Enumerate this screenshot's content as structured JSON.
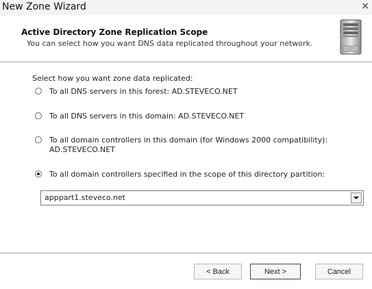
{
  "window": {
    "title": "New Zone Wizard",
    "close_label": "×"
  },
  "header": {
    "title": "Active Directory Zone Replication Scope",
    "subtitle": "You can select how you want DNS data replicated throughout your network.",
    "icon": "server-icon"
  },
  "content": {
    "prompt": "Select how you want zone data replicated:",
    "options": [
      {
        "label": "To all DNS servers in this forest: AD.STEVECO.NET",
        "selected": false
      },
      {
        "label": "To all DNS servers in this domain: AD.STEVECO.NET",
        "selected": false
      },
      {
        "label": "To all domain controllers in this domain (for Windows 2000 compatibility):",
        "label_line2": "AD.STEVECO.NET",
        "selected": false
      },
      {
        "label": "To all domain controllers specified in the scope of this directory partition:",
        "selected": true
      }
    ],
    "partition_select": {
      "value": "apppart1.steveco.net"
    }
  },
  "footer": {
    "back_label": "< Back",
    "next_label": "Next >",
    "cancel_label": "Cancel"
  }
}
